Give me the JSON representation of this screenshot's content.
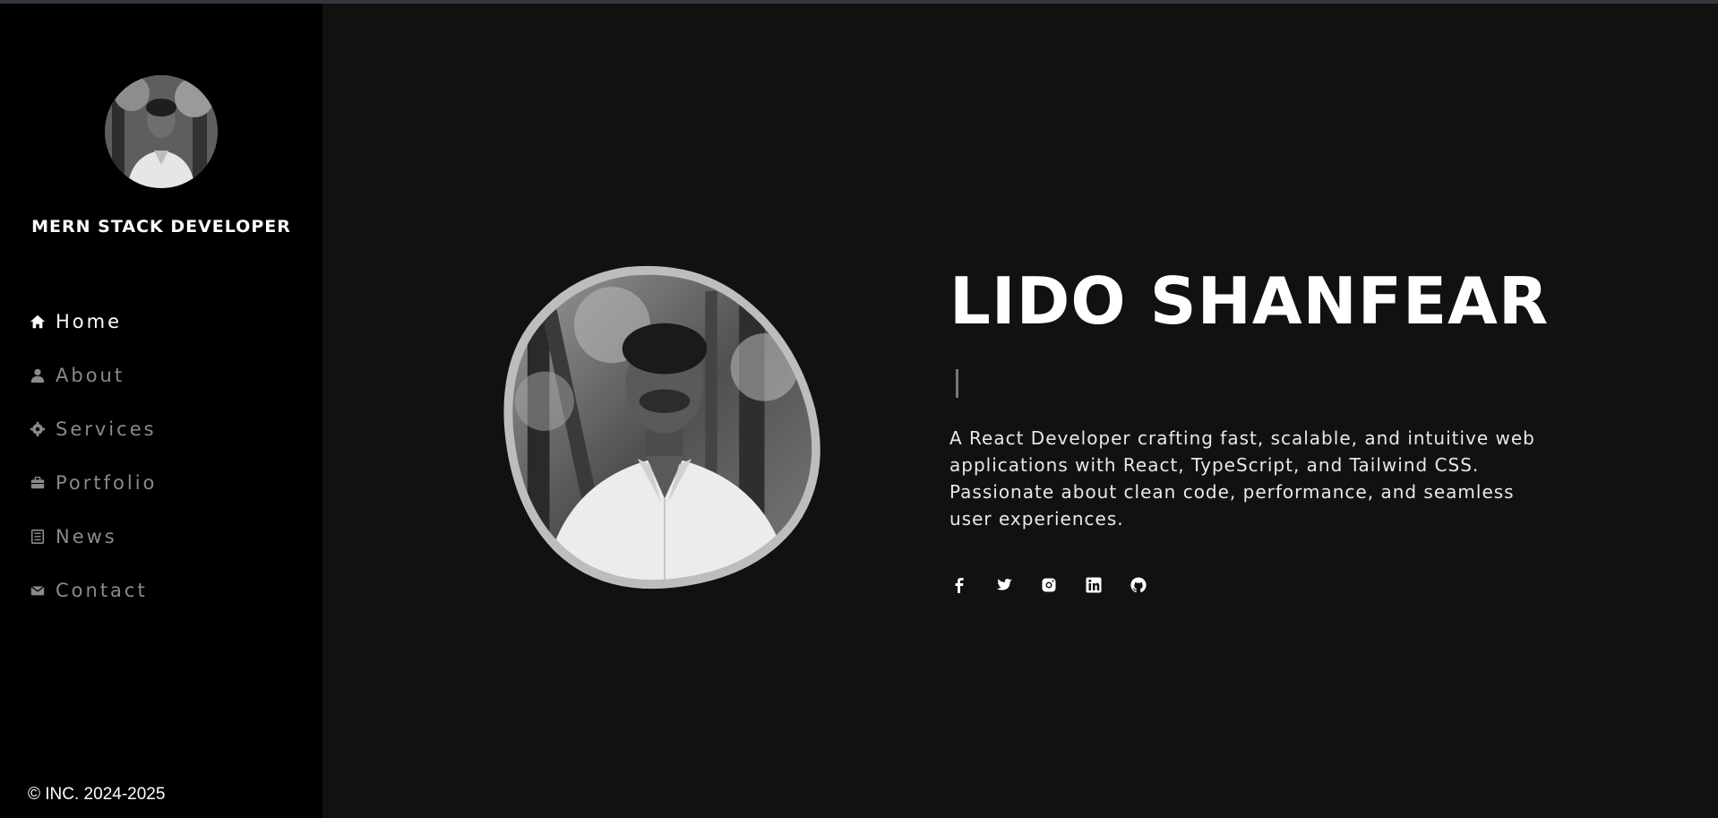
{
  "sidebar": {
    "role": "MERN STACK DEVELOPER",
    "nav": [
      {
        "label": "Home",
        "icon": "home-icon",
        "active": true
      },
      {
        "label": "About",
        "icon": "user-icon",
        "active": false
      },
      {
        "label": "Services",
        "icon": "gear-icon",
        "active": false
      },
      {
        "label": "Portfolio",
        "icon": "briefcase-icon",
        "active": false
      },
      {
        "label": "News",
        "icon": "newspaper-icon",
        "active": false
      },
      {
        "label": "Contact",
        "icon": "envelope-icon",
        "active": false
      }
    ],
    "copyright": "© INC. 2024-2025"
  },
  "hero": {
    "name": "LIDO SHANFEAR",
    "bio": "A React Developer crafting fast, scalable, and intuitive web applications with React, TypeScript, and Tailwind CSS. Passionate about clean code, performance, and seamless user experiences.",
    "socials": [
      "facebook-icon",
      "twitter-icon",
      "instagram-icon",
      "linkedin-icon",
      "github-icon"
    ]
  },
  "colors": {
    "sidebar_bg": "#000000",
    "main_bg": "#111111",
    "active_text": "#ffffff",
    "inactive_text": "#8a8a8a"
  }
}
